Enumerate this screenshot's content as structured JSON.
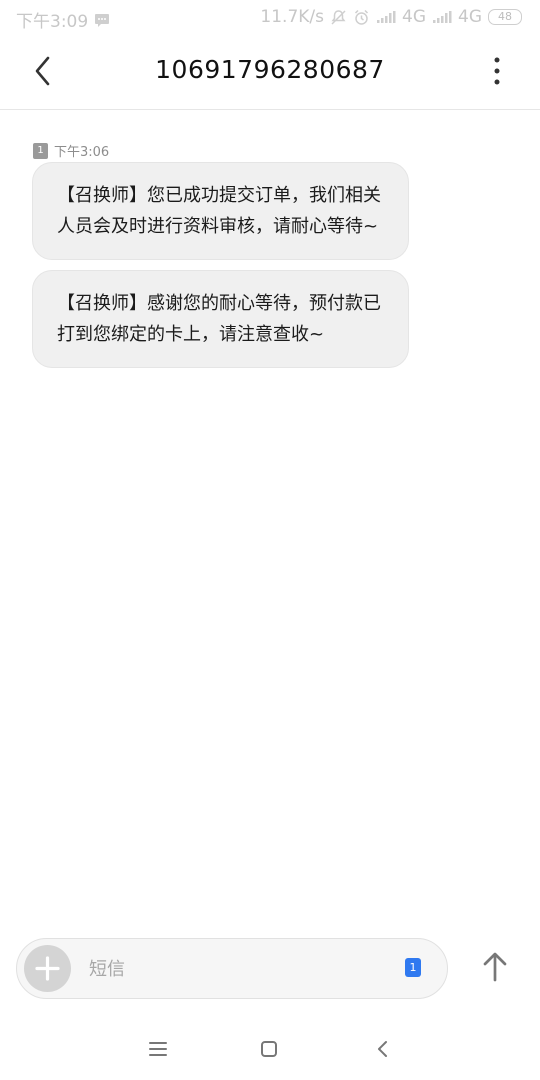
{
  "status_bar": {
    "time": "下午3:09",
    "network_speed": "11.7K/s",
    "signal_1": "4G",
    "signal_2": "4G",
    "battery": "48"
  },
  "header": {
    "title": "10691796280687"
  },
  "messages": {
    "meta_time": "下午3:06",
    "sim_label": "1",
    "items": [
      {
        "text": "【召换师】您已成功提交订单，我们相关人员会及时进行资料审核，请耐心等待~"
      },
      {
        "text": "【召换师】感谢您的耐心等待，预付款已打到您绑定的卡上，请注意查收~"
      }
    ]
  },
  "composer": {
    "placeholder": "短信",
    "sim_label": "1"
  }
}
